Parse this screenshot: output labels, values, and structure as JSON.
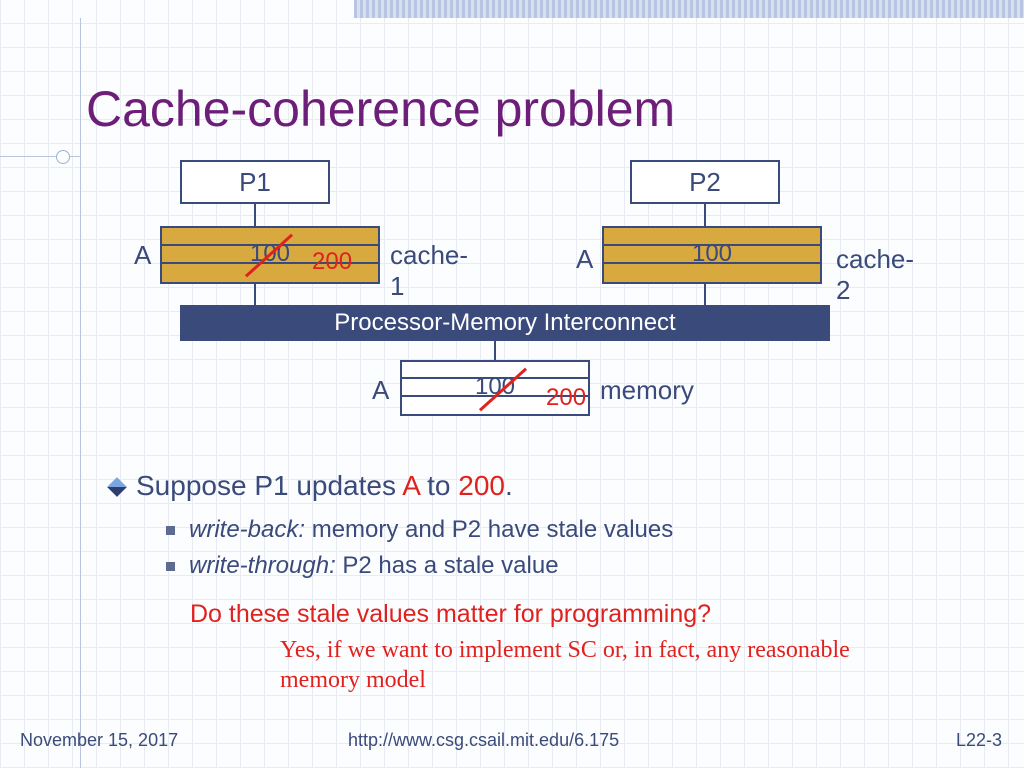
{
  "title": "Cache-coherence problem",
  "proc1": "P1",
  "proc2": "P2",
  "cache1_label": "cache-1",
  "cache2_label": "cache-2",
  "addr_label": "A",
  "old_val": "100",
  "new_val": "200",
  "interconnect": "Processor-Memory Interconnect",
  "memory_label": "memory",
  "bullets": {
    "main_a": "Suppose P1 updates ",
    "main_b": " to ",
    "main_c": ".",
    "sub1_a": "write-back:",
    "sub1_b": "  memory and P2 have stale values",
    "sub2_a": "write-through:",
    "sub2_b": "  P2 has a stale value"
  },
  "question": "Do these stale values matter for programming?",
  "answer": "Yes, if we want to implement SC or, in fact, any reasonable memory model",
  "footer": {
    "date": "November 15, 2017",
    "url": "http://www.csg.csail.mit.edu/6.175",
    "page": "L22-3"
  }
}
